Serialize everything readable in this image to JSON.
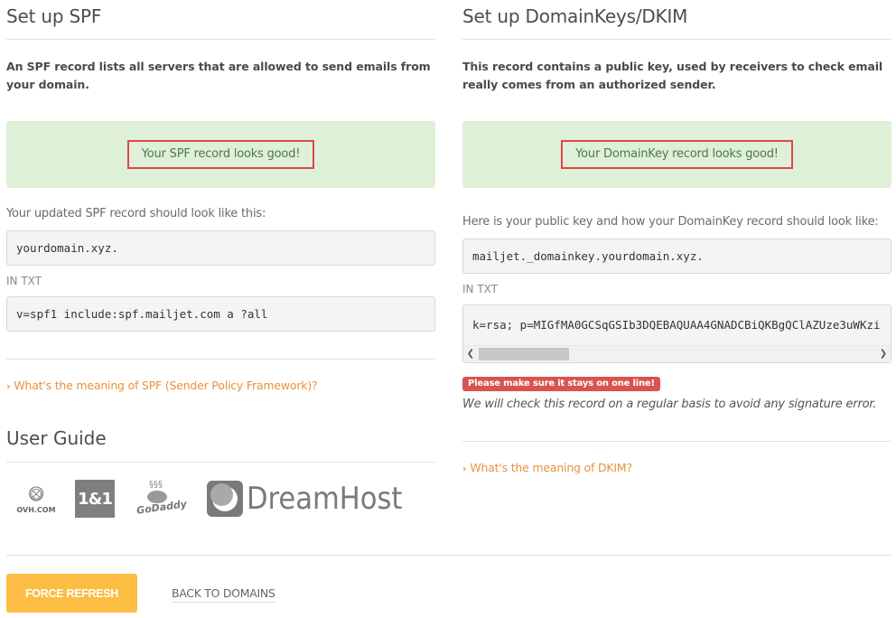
{
  "spf": {
    "title": "Set up SPF",
    "intro": "An SPF record lists all servers that are allowed to send emails from your domain.",
    "status_message": "Your SPF record looks good!",
    "hint": "Your updated SPF record should look like this:",
    "host_value": "yourdomain.xyz.",
    "record_type": "IN TXT",
    "record_value": "v=spf1 include:spf.mailjet.com a ?all",
    "faq_link": "What's the meaning of SPF (Sender Policy Framework)?"
  },
  "dkim": {
    "title": "Set up DomainKeys/DKIM",
    "intro": "This record contains a public key, used by receivers to check email really comes from an authorized sender.",
    "status_message": "Your DomainKey record looks good!",
    "hint": "Here is your public key and how your DomainKey record should look like:",
    "host_value": "mailjet._domainkey.yourdomain.xyz.",
    "record_type": "IN TXT",
    "record_value": "k=rsa; p=MIGfMA0GCSqGSIb3DQEBAQUAA4GNADCBiQKBgQClAZUze3uWKzi",
    "warning_badge": "Please make sure it stays on one line!",
    "note": "We will check this record on a regular basis to avoid any signature error.",
    "faq_link": "What's the meaning of DKIM?"
  },
  "user_guide": {
    "title": "User Guide",
    "providers": [
      {
        "name": "OVH.COM",
        "icon": "ovh-logo"
      },
      {
        "name": "1&1",
        "icon": "1and1-logo"
      },
      {
        "name": "GoDaddy",
        "icon": "godaddy-logo"
      },
      {
        "name": "DreamHost",
        "icon": "dreamhost-logo"
      }
    ]
  },
  "footer": {
    "force_refresh": "FORCE REFRESH",
    "back_to_domains": "BACK TO DOMAINS"
  },
  "colors": {
    "success_bg": "#dff0d8",
    "success_text": "#4b7a45",
    "highlight_border": "#e0464b",
    "link": "#e8913e",
    "warning": "#d9534f",
    "primary_button": "#fbbd43"
  }
}
